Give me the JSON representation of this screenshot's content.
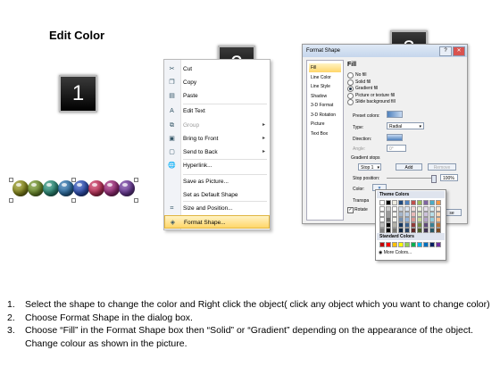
{
  "title": "Edit Color",
  "badges": [
    "1",
    "2",
    "3"
  ],
  "balls": [
    "#8a8c1c",
    "#6e8f2a",
    "#2b8c78",
    "#2b6fa6",
    "#2d4fb4",
    "#c1305a",
    "#9a2a78",
    "#6d3a9a"
  ],
  "context_menu": {
    "items": [
      {
        "label": "Cut",
        "icon": "cut-icon",
        "glyph": "✂",
        "disabled": false,
        "submenu": false,
        "highlight": false
      },
      {
        "label": "Copy",
        "icon": "copy-icon",
        "glyph": "❐",
        "disabled": false,
        "submenu": false,
        "highlight": false
      },
      {
        "label": "Paste",
        "icon": "paste-icon",
        "glyph": "▤",
        "disabled": false,
        "submenu": false,
        "highlight": false
      },
      {
        "label": "Edit Text",
        "icon": "edit-text-icon",
        "glyph": "A",
        "disabled": false,
        "submenu": false,
        "highlight": false
      },
      {
        "label": "Group",
        "icon": "group-icon",
        "glyph": "⧉",
        "disabled": true,
        "submenu": true,
        "highlight": false
      },
      {
        "label": "Bring to Front",
        "icon": "bring-front-icon",
        "glyph": "▣",
        "disabled": false,
        "submenu": true,
        "highlight": false
      },
      {
        "label": "Send to Back",
        "icon": "send-back-icon",
        "glyph": "▢",
        "disabled": false,
        "submenu": true,
        "highlight": false
      },
      {
        "label": "Hyperlink...",
        "icon": "hyperlink-icon",
        "glyph": "🌐",
        "disabled": false,
        "submenu": false,
        "highlight": false
      },
      {
        "label": "Save as Picture...",
        "icon": "",
        "glyph": "",
        "disabled": false,
        "submenu": false,
        "highlight": false
      },
      {
        "label": "Set as Default Shape",
        "icon": "",
        "glyph": "",
        "disabled": false,
        "submenu": false,
        "highlight": false
      },
      {
        "label": "Size and Position...",
        "icon": "size-position-icon",
        "glyph": "⌗",
        "disabled": false,
        "submenu": false,
        "highlight": false
      },
      {
        "label": "Format Shape...",
        "icon": "format-shape-icon",
        "glyph": "◈",
        "disabled": false,
        "submenu": false,
        "highlight": true
      }
    ]
  },
  "dialog": {
    "title": "Format Shape",
    "nav": [
      "Fill",
      "Line Color",
      "Line Style",
      "Shadow",
      "3-D Format",
      "3-D Rotation",
      "Picture",
      "Text Box"
    ],
    "fill_heading": "Fill",
    "options": [
      "No fill",
      "Solid fill",
      "Gradient fill",
      "Picture or texture fill",
      "Slide background fill"
    ],
    "selected_option": 2,
    "preset_colors": "Preset colors:",
    "type_label": "Type:",
    "type_value": "Radial",
    "direction_label": "Direction:",
    "angle_label": "Angle:",
    "angle_value": "0°",
    "gradient_stops": "Gradient stops",
    "stop_value": "Stop 1",
    "add_btn": "Add",
    "remove_btn": "Remove",
    "stop_position": "Stop position:",
    "stop_position_value": "100%",
    "color_label": "Color:",
    "transparency_label": "Transpa",
    "rotate_label": "Rotate",
    "close_btn": "se"
  },
  "palette": {
    "theme_title": "Theme Colors",
    "standard_title": "Standard Colors",
    "more_colors": "More Colors...",
    "theme_columns": [
      "#ffffff",
      "#000000",
      "#eeece1",
      "#1f497d",
      "#4f81bd",
      "#c0504d",
      "#9bbb59",
      "#8064a2",
      "#4bacc6",
      "#f79646"
    ],
    "standard": [
      "#c00000",
      "#ff0000",
      "#ffc000",
      "#ffff00",
      "#92d050",
      "#00b050",
      "#00b0f0",
      "#0070c0",
      "#002060",
      "#7030a0"
    ]
  },
  "instructions": [
    {
      "num": "1.",
      "text": "Select the shape to change the color and Right click the object( click any object which you want to change color)"
    },
    {
      "num": "2.",
      "text": "Choose Format Shape in the dialog box."
    },
    {
      "num": "3.",
      "text": "Choose “Fill” in the Format Shape box then “Solid” or “Gradient” depending on the appearance of the object. Change colour as shown in the picture."
    }
  ]
}
